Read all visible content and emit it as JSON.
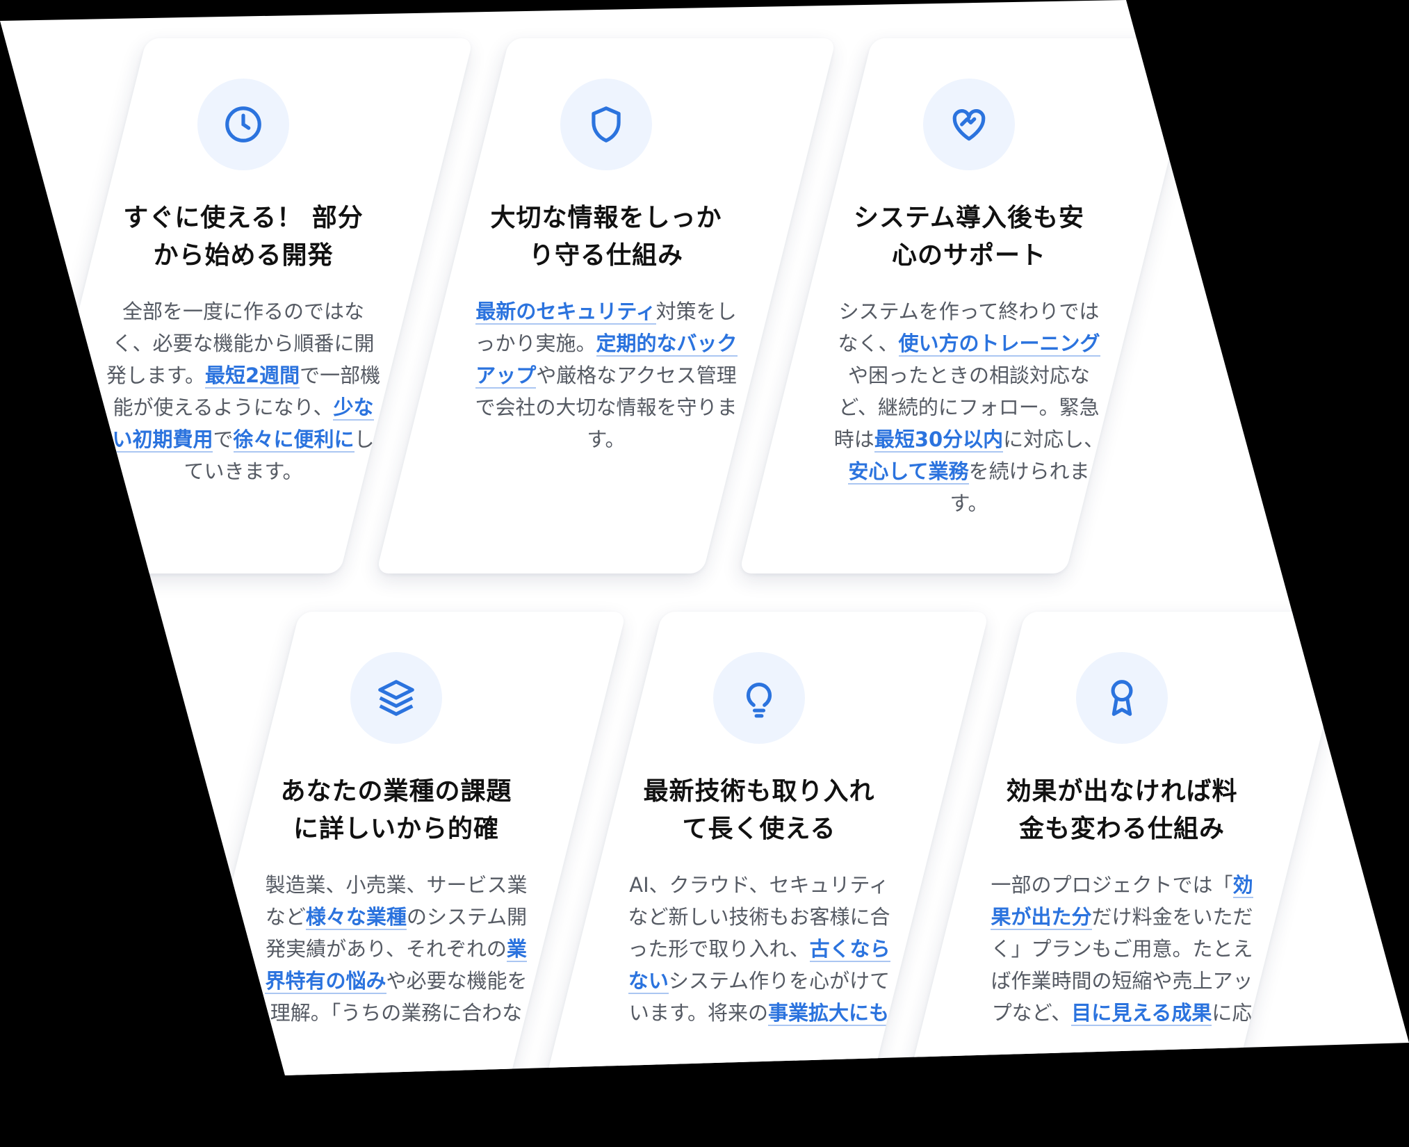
{
  "colors": {
    "accent": "#2b73de",
    "title": "#111111",
    "body": "#555a63",
    "icon_bg": "#eef4fe"
  },
  "cards": [
    {
      "icon": "clock-icon",
      "title_line1": "すぐに使える！ 部分",
      "title_line2": "から始める開発",
      "t0": "全部を一度に作るのではなく、必要な機能から順番に開発します。",
      "h1": "最短2週間",
      "t1": "で一部機能が使えるようになり、",
      "h2": "少ない初期費用",
      "t2": "で",
      "h3": "徐々に便利に",
      "t3": "していきます。"
    },
    {
      "icon": "shield-icon",
      "title_line1": "大切な情報をしっか",
      "title_line2": "り守る仕組み",
      "h1": "最新のセキュリティ",
      "t1": "対策をしっかり実施。",
      "h2": "定期的なバックアップ",
      "t2": "や厳格なアクセス管理で会社の大切な情報を守ります。"
    },
    {
      "icon": "handshake-heart-icon",
      "title_line1": "システム導入後も安",
      "title_line2": "心のサポート",
      "t0": "システムを作って終わりではなく、",
      "h1": "使い方のトレーニング",
      "t1": "や困ったときの相談対応など、継続的にフォロー。緊急時は",
      "h2": "最短30分以内",
      "t2": "に対応し、",
      "h3": "安心して業務",
      "t3": "を続けられます。"
    },
    {
      "icon": "layers-icon",
      "title_line1": "あなたの業種の課題",
      "title_line2": "に詳しいから的確",
      "t0": "製造業、小売業、サービス業など",
      "h1": "様々な業種",
      "t1": "のシステム開発実績があり、それぞれの",
      "h2": "業界特有の悩み",
      "t2": "や必要な機能を理解。「うちの業務に合わな"
    },
    {
      "icon": "lightbulb-icon",
      "title_line1": "最新技術も取り入れ",
      "title_line2": "て長く使える",
      "t0": "AI、クラウド、セキュリティなど新しい技術もお客様に合った形で取り入れ、",
      "h1": "古くならない",
      "t1": "システム作りを心がけています。将来の",
      "h2": "事業拡大にも"
    },
    {
      "icon": "award-icon",
      "title_line1": "効果が出なければ料",
      "title_line2": "金も変わる仕組み",
      "t0": "一部のプロジェクトでは「",
      "h1": "効果が出た分",
      "t1": "だけ料金をいただく」プランもご用意。たとえば作業時間の短縮や売上アップなど、",
      "h2": "目に見える成果",
      "t2": "に応"
    }
  ]
}
